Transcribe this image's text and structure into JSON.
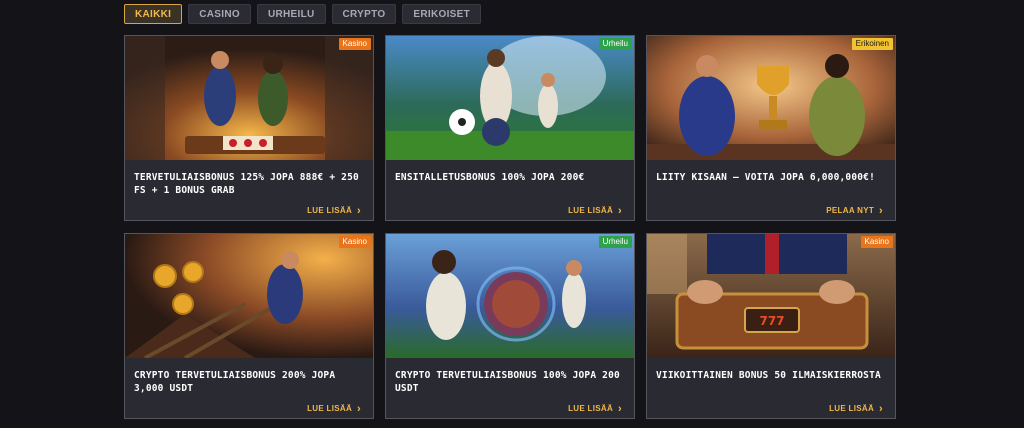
{
  "filters": [
    {
      "label": "KAIKKI",
      "active": true
    },
    {
      "label": "CASINO",
      "active": false
    },
    {
      "label": "URHEILU",
      "active": false
    },
    {
      "label": "CRYPTO",
      "active": false
    },
    {
      "label": "ERIKOISET",
      "active": false
    }
  ],
  "colors": {
    "badge_kasino": "#e8741c",
    "badge_urheilu": "#2fa14a",
    "badge_erikoinen": "#f2c230",
    "accent": "#f0b84a"
  },
  "cards": [
    {
      "badge": "Kasino",
      "title": "TERVETULIAISBONUS 125% JOPA 888€ + 250 FS + 1 BONUS GRAB",
      "cta": "LUE LISÄÄ",
      "icon": "chevron-right-icon"
    },
    {
      "badge": "Urheilu",
      "title": "ENSITALLETUSBONUS 100% JOPA 200€",
      "cta": "LUE LISÄÄ",
      "icon": "chevron-right-icon"
    },
    {
      "badge": "Erikoinen",
      "title": "LIITY KISAAN – VOITA JOPA 6,000,000€!",
      "cta": "PELAA NYT",
      "icon": "chevron-right-icon"
    },
    {
      "badge": "Kasino",
      "title": "CRYPTO TERVETULIAISBONUS 200% JOPA 3,000 USDT",
      "cta": "LUE LISÄÄ",
      "icon": "chevron-right-icon"
    },
    {
      "badge": "Urheilu",
      "title": "CRYPTO TERVETULIAISBONUS 100% JOPA 200 USDT",
      "cta": "LUE LISÄÄ",
      "icon": "chevron-right-icon"
    },
    {
      "badge": "Kasino",
      "title": "VIIKOITTAINEN BONUS 50 ILMAISKIERROSTA",
      "cta": "LUE LISÄÄ",
      "icon": "chevron-right-icon"
    }
  ]
}
